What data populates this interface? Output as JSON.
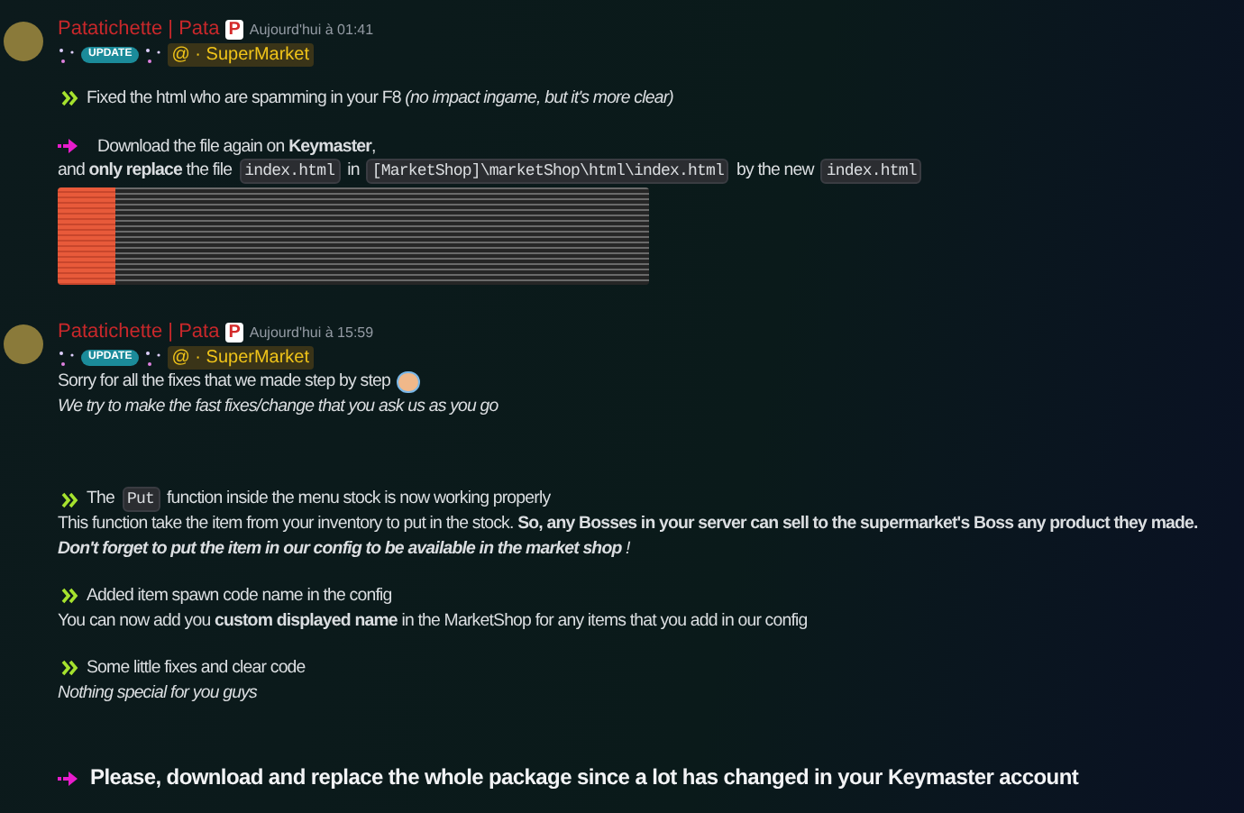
{
  "messages": [
    {
      "author": "Patatichette | Pata",
      "author_badge": "P",
      "timestamp": "Aujourd'hui à 01:41",
      "role_tag": "UPDATE",
      "mention": "@ · SuperMarket",
      "sections": [
        [
          {
            "kind": "bullet",
            "italic": false,
            "parts": [
              {
                "kind": "text",
                "text": "Fixed the html who are spamming in your F8 *(no impact ingame, but it's more clear)*"
              }
            ]
          }
        ],
        [
          {
            "kind": "arrow",
            "italic": false,
            "parts": [
              {
                "kind": "text",
                "text": "Download the file again on **Keymaster**,"
              }
            ]
          },
          {
            "kind": "plain",
            "italic": false,
            "parts": [
              {
                "kind": "text",
                "text": "and **only replace** the file"
              },
              {
                "kind": "code",
                "text": "index.html"
              },
              {
                "kind": "text",
                "text": "in"
              },
              {
                "kind": "code",
                "text": "[MarketShop]\\marketShop\\html\\index.html"
              },
              {
                "kind": "text",
                "text": "by the new"
              },
              {
                "kind": "code",
                "text": "index.html"
              }
            ]
          },
          {
            "kind": "image"
          }
        ]
      ]
    },
    {
      "author": "Patatichette | Pata",
      "author_badge": "P",
      "timestamp": "Aujourd'hui à 15:59",
      "role_tag": "UPDATE",
      "mention": "@ · SuperMarket",
      "sections": [
        [
          {
            "kind": "plain",
            "italic": false,
            "parts": [
              {
                "kind": "text",
                "text": "Sorry for all the fixes that we made step by step"
              },
              {
                "kind": "emoji"
              }
            ]
          },
          {
            "kind": "plain",
            "italic": true,
            "parts": [
              {
                "kind": "text",
                "text": "We try to make the fast fixes/change that you ask us as you go"
              }
            ]
          }
        ],
        [
          {
            "kind": "bullet",
            "italic": false,
            "parts": [
              {
                "kind": "text",
                "text": "The"
              },
              {
                "kind": "code",
                "text": "Put"
              },
              {
                "kind": "text",
                "text": "function inside the menu stock is now working properly"
              }
            ]
          },
          {
            "kind": "plain",
            "italic": false,
            "parts": [
              {
                "kind": "text",
                "text": "This function take the item from your inventory to put in the stock. **So, any Bosses in your server can sell to the supermarket's Boss any product they made.**"
              }
            ]
          },
          {
            "kind": "plain",
            "italic": true,
            "parts": [
              {
                "kind": "text",
                "text": "**Don't forget to put the item in our config to be available in the market shop** !"
              }
            ]
          }
        ],
        [
          {
            "kind": "bullet",
            "italic": false,
            "parts": [
              {
                "kind": "text",
                "text": "Added item spawn code name in the config"
              }
            ]
          },
          {
            "kind": "plain",
            "italic": false,
            "parts": [
              {
                "kind": "text",
                "text": "You can now add you **custom displayed name** in the MarketShop for any items that you add in our config"
              }
            ]
          }
        ],
        [
          {
            "kind": "bullet",
            "italic": false,
            "parts": [
              {
                "kind": "text",
                "text": "Some little fixes and clear code"
              }
            ]
          },
          {
            "kind": "plain",
            "italic": true,
            "parts": [
              {
                "kind": "text",
                "text": "Nothing special for you guys"
              }
            ]
          }
        ],
        [
          {
            "kind": "big_arrow",
            "italic": false,
            "parts": [
              {
                "kind": "text",
                "text": "Please, download and replace the whole package since a lot has changed in your Keymaster account"
              }
            ]
          }
        ]
      ]
    }
  ]
}
